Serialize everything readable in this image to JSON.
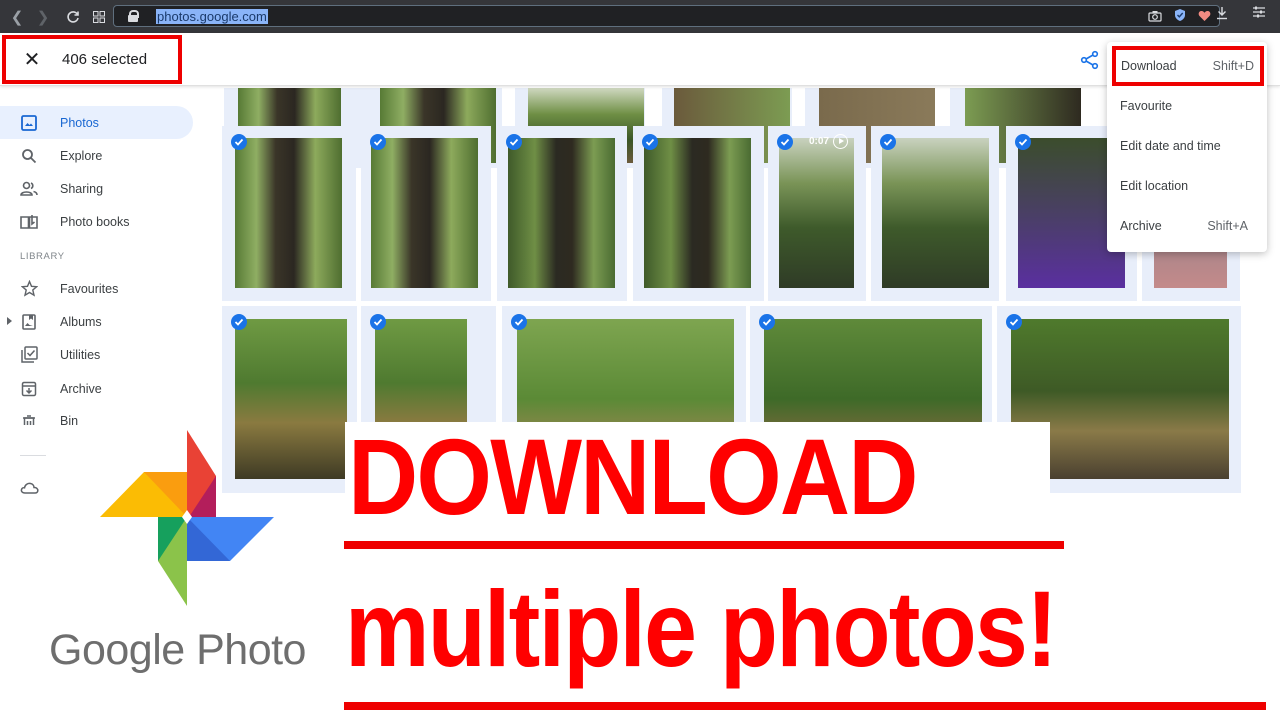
{
  "browser": {
    "url": "photos.google.com",
    "icons": [
      "back-icon",
      "forward-icon",
      "reload-icon",
      "apps-icon",
      "lock-icon",
      "camera-icon",
      "shield-icon",
      "heart-icon",
      "download-icon",
      "menu-icon"
    ]
  },
  "appbar": {
    "close_icon": "close-icon",
    "selection_count": "406 selected",
    "share_icon": "share-icon"
  },
  "sidebar": {
    "items": [
      {
        "label": "Photos",
        "icon": "photos-icon",
        "active": true
      },
      {
        "label": "Explore",
        "icon": "search-icon"
      },
      {
        "label": "Sharing",
        "icon": "people-icon"
      },
      {
        "label": "Photo books",
        "icon": "book-icon"
      }
    ],
    "library_label": "LIBRARY",
    "library_items": [
      {
        "label": "Favourites",
        "icon": "star-icon"
      },
      {
        "label": "Albums",
        "icon": "album-icon"
      },
      {
        "label": "Utilities",
        "icon": "utilities-icon"
      },
      {
        "label": "Archive",
        "icon": "archive-icon"
      },
      {
        "label": "Bin",
        "icon": "trash-icon"
      }
    ]
  },
  "menu": {
    "items": [
      {
        "label": "Download",
        "shortcut": "Shift+D",
        "highlighted": true
      },
      {
        "label": "Favourite",
        "shortcut": ""
      },
      {
        "label": "Edit date and time",
        "shortcut": ""
      },
      {
        "label": "Edit location",
        "shortcut": ""
      },
      {
        "label": "Archive",
        "shortcut": "Shift+A"
      }
    ]
  },
  "grid": {
    "video_duration": "0:07",
    "selected": true
  },
  "overlay": {
    "logo_text": "Google Photo",
    "headline1": "DOWNLOAD",
    "headline2": "multiple photos!",
    "accent_color": "#ff0000"
  }
}
